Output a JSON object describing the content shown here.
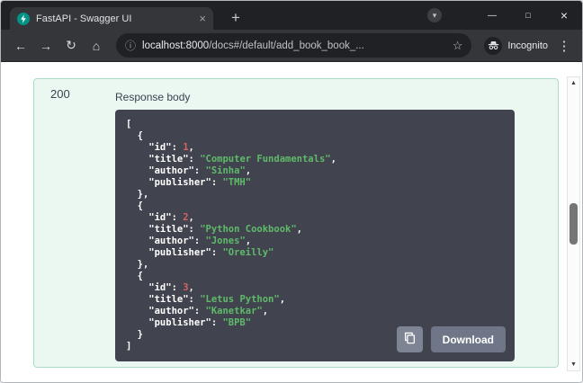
{
  "window": {
    "tab_title": "FastAPI - Swagger UI"
  },
  "toolbar": {
    "url_host": "localhost:8000",
    "url_path": "/docs#/default/add_book_book_...",
    "incognito_label": "Incognito"
  },
  "icons": {
    "back": "←",
    "forward": "→",
    "reload": "↻",
    "home": "⌂",
    "info": "ⓘ",
    "star": "☆",
    "menu": "⋮",
    "minimize": "—",
    "maximize": "□",
    "close": "×",
    "tab_close": "×",
    "new_tab": "+",
    "circle_chevron": "▾",
    "scroll_up": "▲",
    "scroll_down": "▼"
  },
  "colors": {
    "chrome_dark": "#202124",
    "chrome_toolbar": "#35363a",
    "panel_bg": "#ebf7f1",
    "panel_border": "#aadcc3",
    "code_bg": "#41444e",
    "code_plain": "#ffffff",
    "code_string": "#5fba6a",
    "code_number": "#d36363",
    "copy_button_bg": "#7d8493",
    "download_button_bg": "#6e7687"
  },
  "response": {
    "status_code": "200",
    "body_label": "Response body",
    "download_label": "Download",
    "code_lines": [
      [
        {
          "t": "[",
          "y": "p"
        }
      ],
      [
        {
          "t": "  {",
          "y": "p"
        }
      ],
      [
        {
          "t": "    \"id\": ",
          "y": "p"
        },
        {
          "t": "1",
          "y": "n"
        },
        {
          "t": ",",
          "y": "p"
        }
      ],
      [
        {
          "t": "    \"title\": ",
          "y": "p"
        },
        {
          "t": "\"Computer Fundamentals\"",
          "y": "s"
        },
        {
          "t": ",",
          "y": "p"
        }
      ],
      [
        {
          "t": "    \"author\": ",
          "y": "p"
        },
        {
          "t": "\"Sinha\"",
          "y": "s"
        },
        {
          "t": ",",
          "y": "p"
        }
      ],
      [
        {
          "t": "    \"publisher\": ",
          "y": "p"
        },
        {
          "t": "\"TMH\"",
          "y": "s"
        }
      ],
      [
        {
          "t": "  },",
          "y": "p"
        }
      ],
      [
        {
          "t": "  {",
          "y": "p"
        }
      ],
      [
        {
          "t": "    \"id\": ",
          "y": "p"
        },
        {
          "t": "2",
          "y": "n"
        },
        {
          "t": ",",
          "y": "p"
        }
      ],
      [
        {
          "t": "    \"title\": ",
          "y": "p"
        },
        {
          "t": "\"Python Cookbook\"",
          "y": "s"
        },
        {
          "t": ",",
          "y": "p"
        }
      ],
      [
        {
          "t": "    \"author\": ",
          "y": "p"
        },
        {
          "t": "\"Jones\"",
          "y": "s"
        },
        {
          "t": ",",
          "y": "p"
        }
      ],
      [
        {
          "t": "    \"publisher\": ",
          "y": "p"
        },
        {
          "t": "\"Oreilly\"",
          "y": "s"
        }
      ],
      [
        {
          "t": "  },",
          "y": "p"
        }
      ],
      [
        {
          "t": "  {",
          "y": "p"
        }
      ],
      [
        {
          "t": "    \"id\": ",
          "y": "p"
        },
        {
          "t": "3",
          "y": "n"
        },
        {
          "t": ",",
          "y": "p"
        }
      ],
      [
        {
          "t": "    \"title\": ",
          "y": "p"
        },
        {
          "t": "\"Letus Python\"",
          "y": "s"
        },
        {
          "t": ",",
          "y": "p"
        }
      ],
      [
        {
          "t": "    \"author\": ",
          "y": "p"
        },
        {
          "t": "\"Kanetkar\"",
          "y": "s"
        },
        {
          "t": ",",
          "y": "p"
        }
      ],
      [
        {
          "t": "    \"publisher\": ",
          "y": "p"
        },
        {
          "t": "\"BPB\"",
          "y": "s"
        }
      ],
      [
        {
          "t": "  }",
          "y": "p"
        }
      ],
      [
        {
          "t": "]",
          "y": "p"
        }
      ]
    ]
  }
}
